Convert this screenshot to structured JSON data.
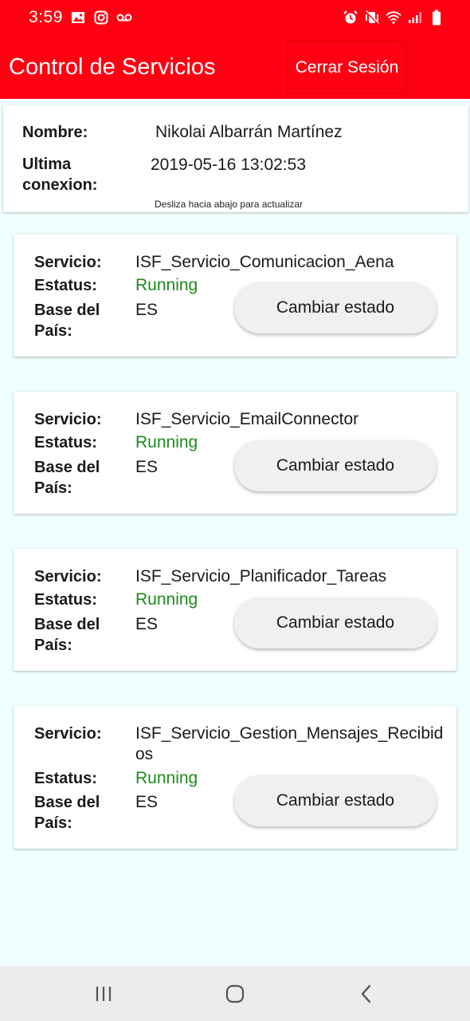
{
  "status_bar": {
    "time": "3:59",
    "left_icons": [
      "image-icon",
      "instagram-icon",
      "voicemail-icon"
    ],
    "right_icons": [
      "alarm-icon",
      "vibrate-icon",
      "wifi-icon",
      "signal-icon",
      "battery-icon"
    ]
  },
  "app_bar": {
    "title": "Control de Servicios",
    "logout_label": "Cerrar Sesión",
    "color": "#ff0012"
  },
  "profile": {
    "name_label": "Nombre:",
    "name_value": "Nikolai Albarrán Martínez",
    "last_conn_label_1": "Ultima",
    "last_conn_label_2": "conexion:",
    "last_conn_value": "2019-05-16 13:02:53",
    "hint": "Desliza hacia abajo para actualizar"
  },
  "services": [
    {
      "service_label": "Servicio:",
      "name": "ISF_Servicio_Comunicacion_Aena",
      "status_label": "Estatus:",
      "status": "Running",
      "country_label_1": "Base del",
      "country_label_2": "País:",
      "country": "ES",
      "button_label": "Cambiar estado"
    },
    {
      "service_label": "Servicio:",
      "name": "ISF_Servicio_EmailConnector",
      "status_label": "Estatus:",
      "status": "Running",
      "country_label_1": "Base del",
      "country_label_2": "País:",
      "country": "ES",
      "button_label": "Cambiar estado"
    },
    {
      "service_label": "Servicio:",
      "name": "ISF_Servicio_Planificador_Tareas",
      "status_label": "Estatus:",
      "status": "Running",
      "country_label_1": "Base del",
      "country_label_2": "País:",
      "country": "ES",
      "button_label": "Cambiar estado"
    },
    {
      "service_label": "Servicio:",
      "name": "ISF_Servicio_Gestion_Mensajes_Recibidos",
      "status_label": "Estatus:",
      "status": "Running",
      "country_label_1": "Base del",
      "country_label_2": "País:",
      "country": "ES",
      "button_label": "Cambiar estado"
    }
  ],
  "status_color": "#1d8a1d",
  "nav_bar": {
    "icons": [
      "recent-apps-icon",
      "home-icon",
      "back-icon"
    ]
  }
}
